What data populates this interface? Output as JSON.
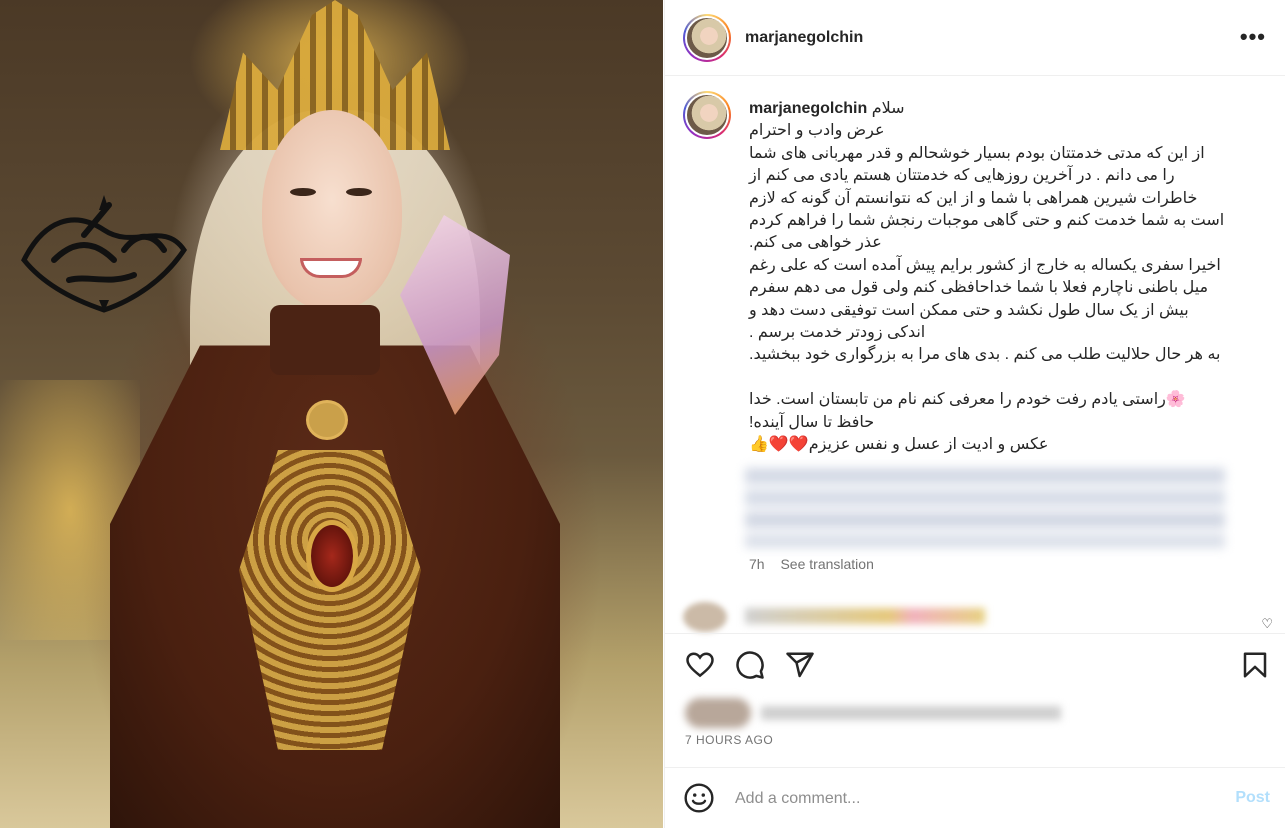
{
  "post": {
    "username": "marjanegolchin",
    "more_label": "•••"
  },
  "caption": {
    "username": "marjanegolchin",
    "lines": [
      "سلام",
      "عرض وادب و احترام",
      "از این که مدتی خدمتتان بودم بسیار خوشحالم و قدر مهربانی های شما",
      "را می دانم . در آخرین روزهایی که خدمتتان هستم یادی می کنم از",
      "خاطرات شیرین همراهی با شما و از این که نتوانستم آن گونه که لازم",
      "است به شما خدمت کنم و حتی گاهی موجبات رنجش شما را فراهم کردم",
      "عذر خواهی می کنم.",
      "اخیرا سفری یکساله به خارج از کشور برایم پیش آمده است که علی رغم",
      "میل باطنی ناچارم فعلا با شما خداحافظی کنم ولی قول می دهم سفرم",
      "بیش از یک سال طول نکشد و حتی ممکن است توفیقی دست دهد و",
      "اندکی زودتر خدمت برسم .",
      "به هر حال حلالیت طلب می کنم . بدی های مرا به بزرگواری خود ببخشید.",
      "",
      "🌸راستی یادم رفت خودم را معرفی کنم نام من تابستان است. خدا",
      "حافظ تا سال آینده!",
      "عکس و ادیت از عسل و نفس عزیزم❤️❤️👍"
    ],
    "age": "7h",
    "translate_label": "See translation"
  },
  "time_label": "7 HOURS AGO",
  "comment_box": {
    "placeholder": "Add a comment...",
    "post_label": "Post"
  },
  "icons": {
    "like": "heart-icon",
    "comment": "comment-icon",
    "share": "paper-plane-icon",
    "save": "bookmark-icon",
    "emoji": "smiley-icon",
    "more": "ellipsis-icon"
  },
  "colors": {
    "text": "#262626",
    "muted": "#737373",
    "post_disabled": "#b2dffc",
    "divider": "#efefef"
  }
}
